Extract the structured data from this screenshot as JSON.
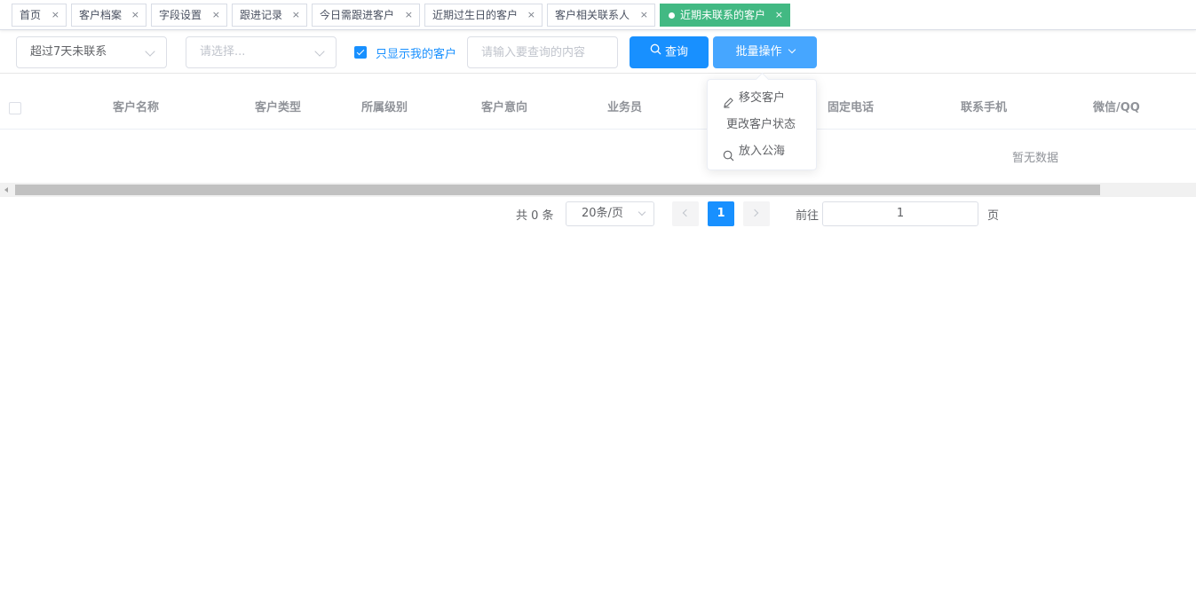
{
  "tabs": [
    {
      "label": "首页",
      "active": false
    },
    {
      "label": "客户档案",
      "active": false
    },
    {
      "label": "字段设置",
      "active": false
    },
    {
      "label": "跟进记录",
      "active": false
    },
    {
      "label": "今日需跟进客户",
      "active": false
    },
    {
      "label": "近期过生日的客户",
      "active": false
    },
    {
      "label": "客户相关联系人",
      "active": false
    },
    {
      "label": "近期未联系的客户",
      "active": true
    }
  ],
  "tab_close_glyph": "×",
  "active_tab_color": "#42b983",
  "filters": {
    "time_select_value": "超过7天未联系",
    "type_select_placeholder": "请选择...",
    "only_mine_label": "只显示我的客户",
    "only_mine_checked": true,
    "search_placeholder": "请输入要查询的内容"
  },
  "buttons": {
    "search_label": "查询",
    "batch_label": "批量操作",
    "primary_color": "#1890ff"
  },
  "dropdown": {
    "items": [
      {
        "label": "移交客户",
        "icon": "edit-icon"
      },
      {
        "label": "更改客户状态",
        "icon": ""
      },
      {
        "label": "放入公海",
        "icon": "search-icon"
      }
    ]
  },
  "table": {
    "columns": [
      "客户名称",
      "客户类型",
      "所属级别",
      "客户意向",
      "业务员",
      "固定电话",
      "联系手机",
      "微信/QQ"
    ],
    "empty_text": "暂无数据"
  },
  "pagination": {
    "total_text": "共 0 条",
    "page_size": "20条/页",
    "current_page": "1",
    "goto_label": "前往",
    "goto_value": "1",
    "page_suffix": "页"
  }
}
